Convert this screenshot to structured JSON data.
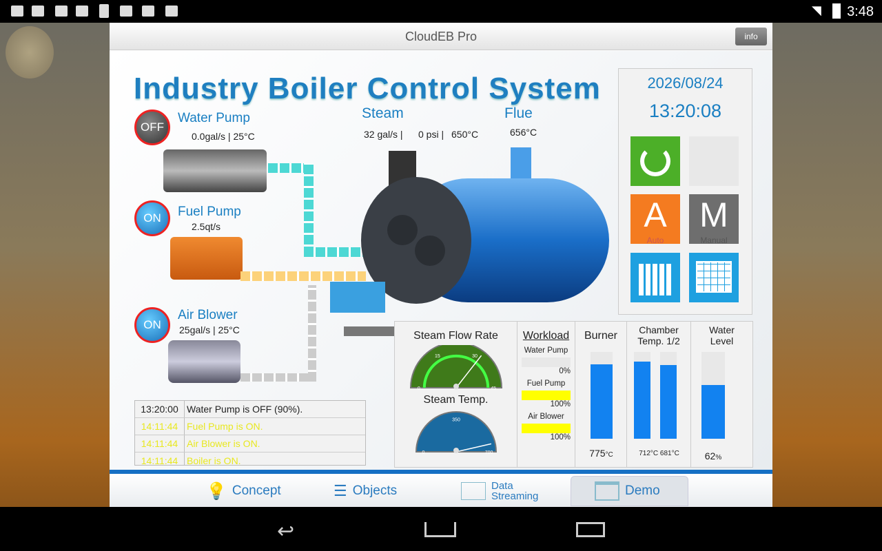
{
  "status_bar": {
    "time": "3:48",
    "icons": [
      "image-icon",
      "cloud-upload-icon",
      "barcode-icon",
      "mail-icon",
      "tablet-icon",
      "play-store-icon",
      "checkbox-icon",
      "barcode-icon"
    ]
  },
  "app": {
    "title": "CloudEB Pro",
    "info_label": "info"
  },
  "dashboard": {
    "heading": "Industry Boiler Control System",
    "steam": {
      "label": "Steam",
      "flow": "32 gal/s |",
      "pressure": "0 psi |",
      "temp": "650°C"
    },
    "flue": {
      "label": "Flue",
      "temp": "656°C"
    },
    "water_pump": {
      "label": "Water Pump",
      "state": "OFF",
      "readout": "0.0gal/s | 25°C"
    },
    "fuel_pump": {
      "label": "Fuel Pump",
      "state": "ON",
      "readout": "2.5qt/s"
    },
    "air_blower": {
      "label": "Air Blower",
      "state": "ON",
      "readout": "25gal/s | 25°C"
    },
    "date": "2026/08/24",
    "time": "13:20:08",
    "tiles": {
      "auto_letter": "A",
      "auto_label": "Auto",
      "manual_letter": "M",
      "manual_label": "Manual"
    },
    "log": [
      {
        "time": "13:20:00",
        "msg": "Water Pump is OFF (90%).",
        "color": "#222222"
      },
      {
        "time": "14:11:44",
        "msg": "Fuel Pump is ON.",
        "color": "#e8e820"
      },
      {
        "time": "14:11:44",
        "msg": "Air Blower is ON.",
        "color": "#e8e820"
      },
      {
        "time": "14:11:44",
        "msg": "Boiler is ON.",
        "color": "#e8e820"
      }
    ],
    "steam_flow_gauge": {
      "title": "Steam Flow Rate",
      "ticks": [
        "0",
        "15",
        "30",
        "45"
      ],
      "value": 32,
      "max": 45
    },
    "steam_temp_gauge": {
      "title": "Steam Temp.",
      "ticks": [
        "0",
        "350",
        "700"
      ],
      "value": 650,
      "max": 700
    },
    "workload": {
      "title": "Workload",
      "items": [
        {
          "label": "Water Pump",
          "value": "0%",
          "fraction": 0
        },
        {
          "label": "Fuel Pump",
          "value": "100%",
          "fraction": 1
        },
        {
          "label": "Air Blower",
          "value": "100%",
          "fraction": 1
        }
      ]
    },
    "burner": {
      "title": "Burner",
      "value": "775",
      "unit": "°C",
      "fraction": 0.86
    },
    "chamber": {
      "title_1": "Chamber",
      "title_2": "Temp. 1/2",
      "value1": "712°C",
      "value2": "681°C",
      "fraction1": 0.89,
      "fraction2": 0.85
    },
    "water_level": {
      "title_1": "Water",
      "title_2": "Level",
      "value": "62",
      "unit": "%",
      "fraction": 0.62
    }
  },
  "tabs": [
    {
      "label": "Concept"
    },
    {
      "label": "Objects"
    },
    {
      "label_1": "Data",
      "label_2": "Streaming"
    },
    {
      "label": "Demo",
      "selected": true
    }
  ],
  "colors": {
    "accent": "#1670c4",
    "bar_fill": "#1282f0",
    "workload_fill": "#ffff00",
    "power_tile": "#4caf28",
    "auto_tile": "#f47b20",
    "manual_tile": "#6e6e6e",
    "chart_tile": "#1ea0e0"
  }
}
